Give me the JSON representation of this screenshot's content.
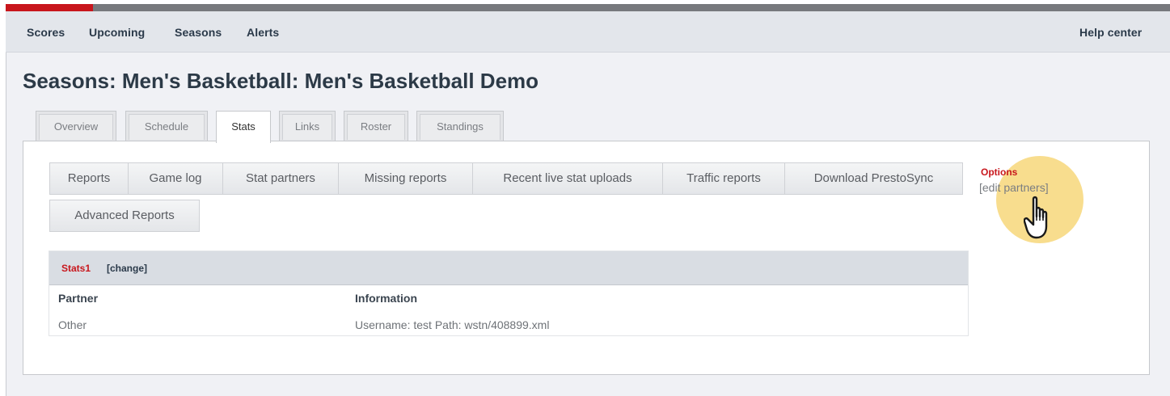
{
  "progress": {
    "percent": 7.5,
    "fill_color": "#c8161c",
    "track_color": "#77797d"
  },
  "top_nav": {
    "items": [
      "Scores",
      "Upcoming",
      "Seasons",
      "Alerts"
    ],
    "help": "Help center"
  },
  "page_title": "Seasons: Men's Basketball: Men's Basketball Demo",
  "tabs": [
    {
      "label": "Overview",
      "active": false
    },
    {
      "label": "Schedule",
      "active": false
    },
    {
      "label": "Stats",
      "active": true
    },
    {
      "label": "Links",
      "active": false
    },
    {
      "label": "Roster",
      "active": false
    },
    {
      "label": "Standings",
      "active": false
    }
  ],
  "subtabs": [
    "Reports",
    "Game log",
    "Stat partners",
    "Missing reports",
    "Recent live stat uploads",
    "Traffic reports",
    "Download PrestoSync",
    "Advanced Reports"
  ],
  "options": {
    "title": "Options",
    "edit_link_open": "[",
    "edit_link_text": "edit partners",
    "edit_link_close": "]",
    "cursor_icon": "hand-pointer-icon",
    "highlight_color": "#f6d46e"
  },
  "stats_table": {
    "season_name": "Stats1",
    "change_label": "[change]",
    "columns": [
      "Partner",
      "Information"
    ],
    "rows": [
      [
        "Other",
        "Username: test Path: wstn/408899.xml"
      ]
    ]
  },
  "colors": {
    "accent_red": "#c8161c",
    "nav_bg": "#e3e6eb",
    "text_dark": "#2c3a47"
  }
}
